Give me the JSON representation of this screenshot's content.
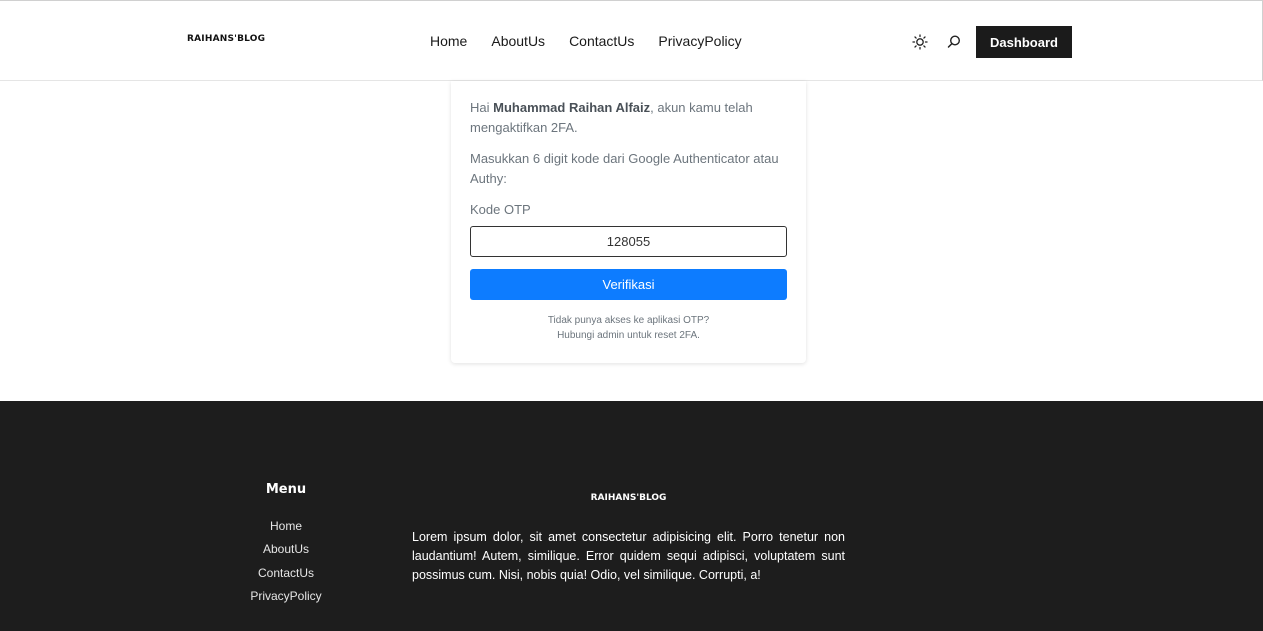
{
  "header": {
    "logo": "RAIHANS'BLOG",
    "nav": [
      "Home",
      "AboutUs",
      "ContactUs",
      "PrivacyPolicy"
    ],
    "icons": [
      "sun-icon",
      "search-icon"
    ],
    "dashboard_label": "Dashboard"
  },
  "card": {
    "greeting_prefix": "Hai ",
    "user_name": "Muhammad Raihan Alfaiz",
    "greeting_suffix": ", akun kamu telah mengaktifkan 2FA.",
    "instruction": "Masukkan 6 digit kode dari Google Authenticator atau Authy:",
    "otp_label": "Kode OTP",
    "otp_value": "128055",
    "verify_label": "Verifikasi",
    "help_line1": "Tidak punya akses ke aplikasi OTP?",
    "help_line2": "Hubungi admin untuk reset 2FA."
  },
  "footer": {
    "menu_title": "Menu",
    "menu_items": [
      "Home",
      "AboutUs",
      "ContactUs",
      "PrivacyPolicy"
    ],
    "logo": "RAIHANS'BLOG",
    "text": "Lorem ipsum dolor, sit amet consectetur adipisicing elit. Porro tenetur non laudantium! Autem, similique. Error quidem sequi adipisci, voluptatem sunt possimus cum. Nisi, nobis quia! Odio, vel similique. Corrupti, a!"
  },
  "colors": {
    "accent": "#0d7cff",
    "dark": "#1b1b1b",
    "footer_bg": "#1d1d1d"
  }
}
